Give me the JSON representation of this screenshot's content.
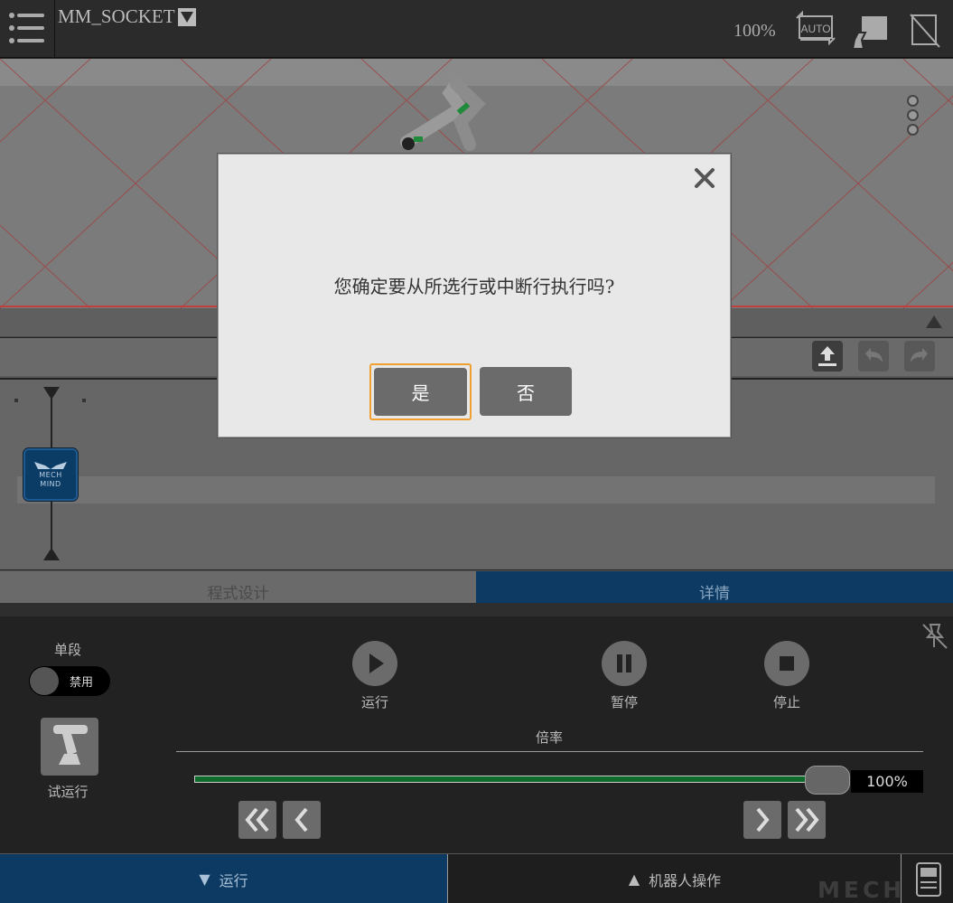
{
  "header": {
    "program_name": "MM_SOCKET",
    "speed": "100%",
    "icons": [
      "menu-icon",
      "auto-mode-icon",
      "robot-teach-icon",
      "no-device-icon"
    ]
  },
  "viewport": {
    "icons": [
      "more-options-icon"
    ]
  },
  "timeline": {
    "toolbar_icons": [
      "upload-icon",
      "undo-icon",
      "redo-icon"
    ],
    "node": {
      "line1": "MECH",
      "line2": "MIND"
    }
  },
  "tabs": {
    "program_design": "程式设计",
    "details": "详情"
  },
  "dialog": {
    "message": "您确定要从所选行或中断行执行吗?",
    "yes": "是",
    "no": "否"
  },
  "controls": {
    "single_step_label": "单段",
    "single_step_state": "禁用",
    "trial_run_label": "试运行",
    "run_label": "运行",
    "pause_label": "暂停",
    "stop_label": "停止",
    "rate_label": "倍率",
    "rate_value": "100%",
    "rate_fraction": 1.0
  },
  "bottom_bar": {
    "run_tab": "运行",
    "robot_ops_tab": "机器人操作",
    "watermark": "MECH MIND"
  },
  "colors": {
    "accent_blue": "#0c3a63",
    "progress_green": "#0f6b2c",
    "focus_orange": "#f0a030"
  }
}
